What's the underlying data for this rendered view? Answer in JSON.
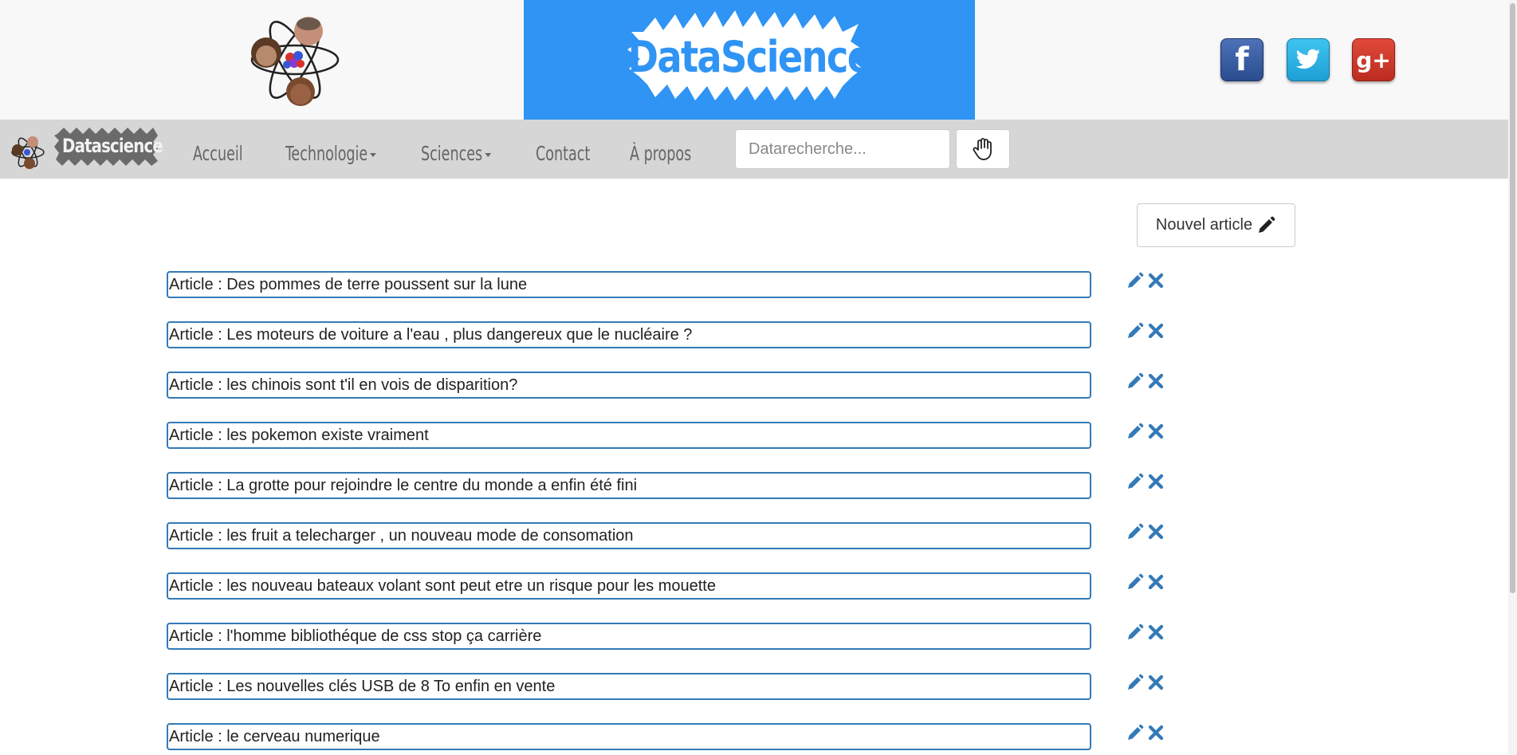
{
  "header": {
    "banner_title": "DataScience",
    "social": [
      {
        "name": "facebook",
        "glyph": "f",
        "color": "#3b5998"
      },
      {
        "name": "twitter",
        "glyph": "🐦",
        "color": "#1da1f2"
      },
      {
        "name": "google-plus",
        "glyph": "g+",
        "color": "#d34836"
      }
    ]
  },
  "navbar": {
    "brand": "Datascience",
    "items": [
      {
        "label": "Accueil",
        "dropdown": false
      },
      {
        "label": "Technologie",
        "dropdown": true
      },
      {
        "label": "Sciences",
        "dropdown": true
      },
      {
        "label": "Contact",
        "dropdown": false
      },
      {
        "label": "À propos",
        "dropdown": false
      }
    ],
    "search": {
      "placeholder": "Datarecherche...",
      "value": ""
    },
    "search_button_icon": "hand-icon"
  },
  "main": {
    "new_article_label": "Nouvel article",
    "articles": [
      {
        "title": "Article : Des pommes de terre poussent sur la lune"
      },
      {
        "title": "Article : Les moteurs de voiture a l'eau , plus dangereux que le nucléaire ?"
      },
      {
        "title": "Article : les chinois sont t'il en vois de disparition?"
      },
      {
        "title": "Article : les pokemon existe vraiment"
      },
      {
        "title": "Article : La grotte pour rejoindre le centre du monde a enfin été fini"
      },
      {
        "title": "Article : les fruit a telecharger , un nouveau mode de consomation"
      },
      {
        "title": "Article : les nouveau bateaux volant sont peut etre un risque pour les mouette"
      },
      {
        "title": "Article : l'homme bibliothéque de css stop ça carrière"
      },
      {
        "title": "Article : Les nouvelles clés USB de 8 To enfin en vente"
      },
      {
        "title": "Article : le cerveau numerique"
      }
    ]
  },
  "colors": {
    "banner": "#2f94f4",
    "navbar": "#d6d6d6",
    "accent": "#337ab7"
  }
}
